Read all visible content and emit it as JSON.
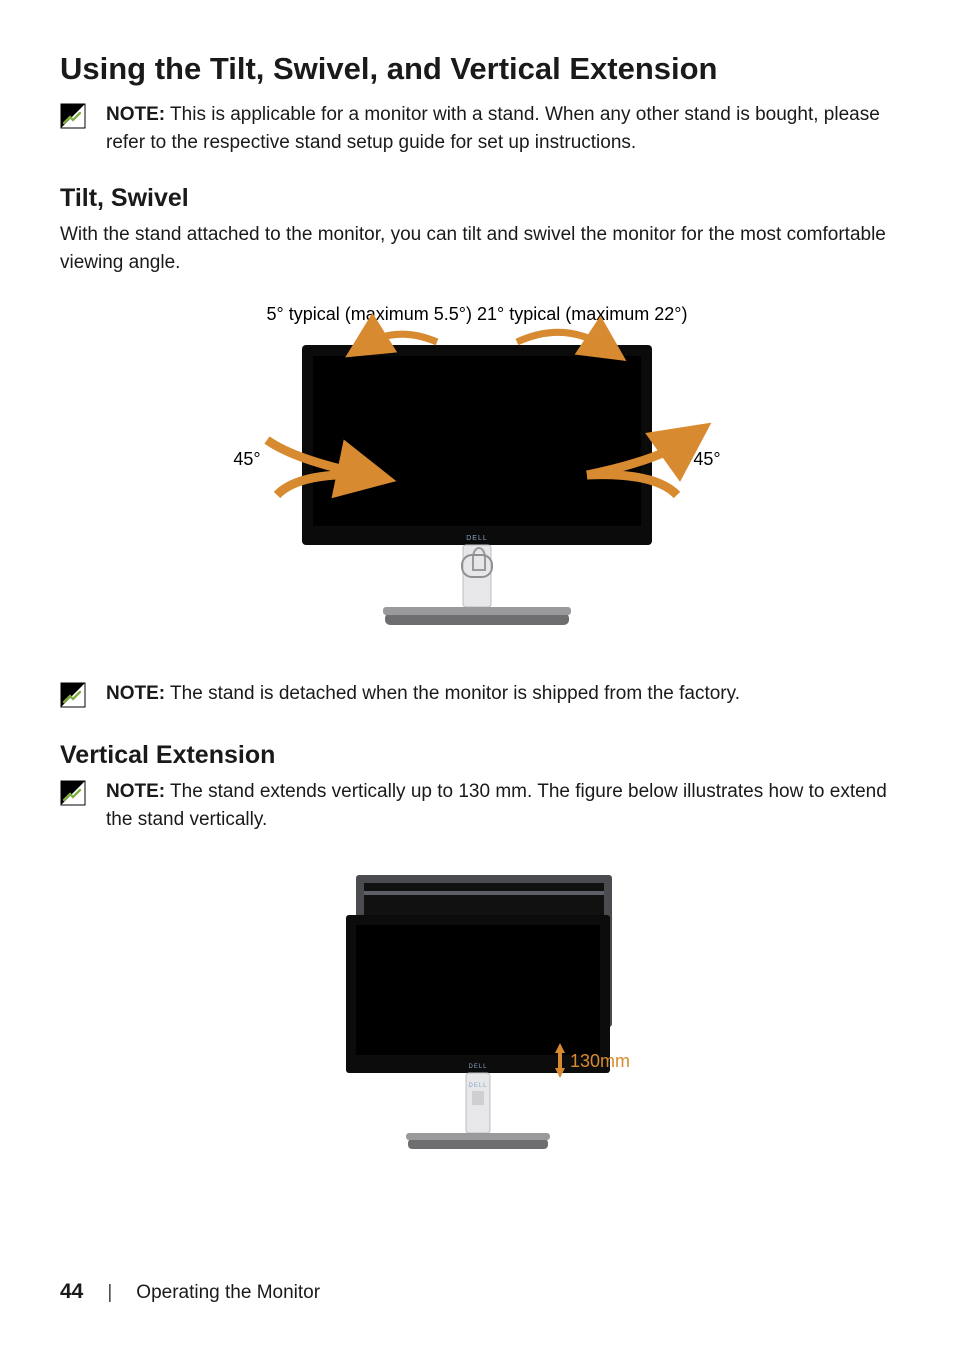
{
  "heading": "Using the Tilt, Swivel, and Vertical Extension",
  "notes": {
    "n1": {
      "lead": "NOTE:",
      "text": " This is applicable for a monitor with a stand. When any other stand is bought, please refer to the respective stand setup guide for set up instructions."
    },
    "n2": {
      "lead": "NOTE:",
      "text": " The stand is detached when the monitor is shipped from the factory."
    },
    "n3": {
      "lead": "NOTE:",
      "text": " The stand extends vertically up to 130 mm. The figure below illustrates how to extend the stand vertically."
    }
  },
  "sections": {
    "s1": {
      "title": "Tilt, Swivel",
      "para": "With the stand attached to the monitor, you can tilt and swivel the monitor for the most comfortable viewing angle."
    },
    "s2": {
      "title": "Vertical Extension"
    }
  },
  "diagram1": {
    "topLeft": "5° typical (maximum 5.5°)",
    "topRight": "21° typical (maximum 22°)",
    "left": "45°",
    "right": "45°"
  },
  "diagram2": {
    "height": "130mm"
  },
  "footer": {
    "page": "44",
    "section": "Operating the Monitor"
  }
}
